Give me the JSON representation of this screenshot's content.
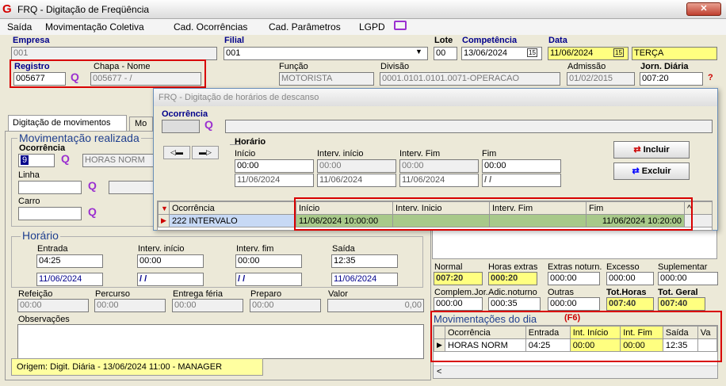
{
  "window": {
    "title": "FRQ - Digitação de Freqüência",
    "close": "✕"
  },
  "menu": [
    "Saída",
    "Movimentação Coletiva",
    "Cad. Ocorrências",
    "Cad. Parâmetros",
    "LGPD"
  ],
  "header": {
    "empresa_label": "Empresa",
    "empresa_value": "001",
    "filial_label": "Filial",
    "filial_value": "001",
    "lote_label": "Lote",
    "lote_value": "00",
    "competencia_label": "Competência",
    "competencia_value": "13/06/2024",
    "data_label": "Data",
    "data_value": "11/06/2024",
    "weekday": "TERÇA",
    "registro_label": "Registro",
    "registro_value": "005677",
    "chapa_label": "Chapa  -  Nome",
    "chapa_value": "005677 - /",
    "funcao_label": "Função",
    "funcao_value": "MOTORISTA",
    "divisao_label": "Divisão",
    "divisao_value": "0001.0101.0101.0071-OPERACAO",
    "admissao_label": "Admissão",
    "admissao_value": "01/02/2015",
    "jornada_label": "Jorn. Diária",
    "jornada_value": "007:20",
    "help": "?"
  },
  "tabs": [
    "Digitação de movimentos",
    "Mo"
  ],
  "main": {
    "mov_title": "Movimentação realizada",
    "ocorrencia_label": "Ocorrência",
    "ocorrencia_code": "9",
    "ocorrencia_desc": "HORAS NORM",
    "linha_label": "Linha",
    "carro_label": "Carro",
    "horario_title": "Horário",
    "entrada_label": "Entrada",
    "entrada_value": "04:25",
    "entrada_date": "11/06/2024",
    "int_ini_label": "Interv. início",
    "int_ini_value": "00:00",
    "int_ini_date": "/ /",
    "int_fim_label": "Interv. fim",
    "int_fim_value": "00:00",
    "int_fim_date": "/ /",
    "saida_label": "Saída",
    "saida_value": "12:35",
    "saida_date": "11/06/2024",
    "refeicao_label": "Refeição",
    "refeicao_value": "00:00",
    "percurso_label": "Percurso",
    "percurso_value": "00:00",
    "entrega_label": "Entrega féria",
    "entrega_value": "00:00",
    "preparo_label": "Preparo",
    "preparo_value": "00:00",
    "valor_label": "Valor",
    "valor_value": "0,00",
    "obs_label": "Observações",
    "origem": "Origem: Digit. Diária - 13/06/2024 11:00 - MANAGER"
  },
  "totals": {
    "labels1": [
      "Normal",
      "Horas extras",
      "Extras noturn.",
      "Excesso",
      "Suplementar"
    ],
    "values1": [
      "007:20",
      "000:20",
      "000:00",
      "000:00",
      "000:00"
    ],
    "labels2": [
      "Complem.Jor.",
      "Adic.noturno",
      "Outras",
      "Tot.Horas",
      "Tot. Geral"
    ],
    "values2": [
      "000:00",
      "000:35",
      "000:00",
      "007:40",
      "007:40"
    ]
  },
  "movdia": {
    "title": "Movimentações do dia",
    "key": "(F6)",
    "columns": [
      "Ocorrência",
      "Entrada",
      "Int. Início",
      "Int. Fim",
      "Saída",
      "Va"
    ],
    "rows": [
      [
        "HORAS NORM",
        "04:25",
        "00:00",
        "00:00",
        "12:35",
        ""
      ]
    ]
  },
  "dialog": {
    "title": "FRQ - Digitação de horários de descanso",
    "ocorrencia_label": "Ocorrência",
    "horario_title": "Horário",
    "inicio_label": "Início",
    "inicio_value": "00:00",
    "inicio_date": "11/06/2024",
    "int_ini_label": "Interv. início",
    "int_ini_value": "00:00",
    "int_ini_date": "11/06/2024",
    "int_fim_label": "Interv. Fim",
    "int_fim_value": "00:00",
    "int_fim_date": "11/06/2024",
    "fim_label": "Fim",
    "fim_value": "00:00",
    "fim_date": "/ /",
    "incluir": "Incluir",
    "excluir": "Excluir",
    "columns": [
      "Ocorrência",
      "Início",
      "Interv. Inicio",
      "Interv. Fim",
      "Fim"
    ],
    "rows": [
      [
        "222 INTERVALO",
        "11/06/2024 10:00:00",
        "",
        "",
        "11/06/2024 10:20:00"
      ]
    ]
  }
}
